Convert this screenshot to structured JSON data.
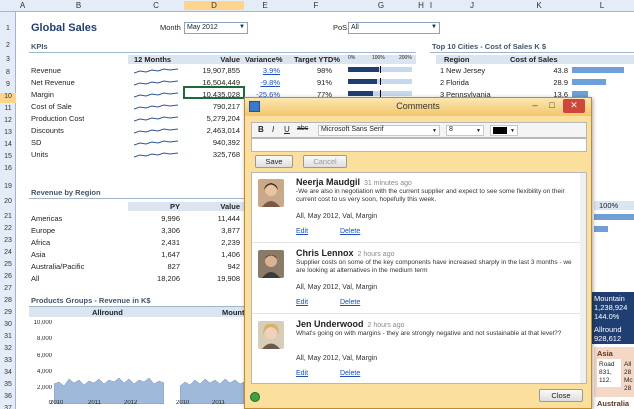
{
  "columns": [
    "A",
    "B",
    "C",
    "D",
    "E",
    "F",
    "G",
    "H",
    "I",
    "J",
    "K",
    "L"
  ],
  "rows": [
    "1",
    "2",
    "3",
    "8",
    "9",
    "10",
    "11",
    "12",
    "13",
    "14",
    "15",
    "16",
    "19",
    "20",
    "21",
    "22",
    "23",
    "24",
    "25",
    "26",
    "27",
    "28",
    "29",
    "30",
    "31",
    "32",
    "33",
    "34",
    "35",
    "36",
    "37",
    "38",
    "39",
    "40"
  ],
  "title": "Global Sales",
  "month_label": "Month",
  "month_value": "May 2012",
  "pos_label": "PoS",
  "pos_value": "All",
  "kpis_header": "KPIs",
  "kpi_columns": {
    "months": "12 Months",
    "value": "Value",
    "variance": "Variance%",
    "target": "Target YTD%"
  },
  "target_ticks": [
    "0%",
    "100%",
    "200%"
  ],
  "kpis": [
    {
      "name": "Revenue",
      "value": "19,907,855",
      "variance": "3.9%",
      "target": "98%",
      "target_fill": 0.49
    },
    {
      "name": "Net Revenue",
      "value": "16,504,449",
      "variance": "-9.8%",
      "target": "91%",
      "target_fill": 0.455
    },
    {
      "name": "Margin",
      "value": "10,435,028",
      "variance": "-25.6%",
      "target": "77%",
      "target_fill": 0.385
    },
    {
      "name": "Cost of Sale",
      "value": "790,217",
      "variance": "",
      "target": "",
      "target_fill": 0
    },
    {
      "name": "Production Cost",
      "value": "5,279,204",
      "variance": "",
      "target": "",
      "target_fill": 0
    },
    {
      "name": "Discounts",
      "value": "2,463,014",
      "variance": "",
      "target": "",
      "target_fill": 0
    },
    {
      "name": "SD",
      "value": "940,392",
      "variance": "",
      "target": "",
      "target_fill": 0
    },
    {
      "name": "Units",
      "value": "325,768",
      "variance": "",
      "target": "",
      "target_fill": 0
    }
  ],
  "top_cities_header": "Top 10 Cities - Cost of Sales K $",
  "top_cities_columns": {
    "region": "Region",
    "cos": "Cost of Sales"
  },
  "top_cities": [
    {
      "rank": "1",
      "region": "New Jersey",
      "value": "43.8",
      "fill": 1.0
    },
    {
      "rank": "2",
      "region": "Florida",
      "value": "28.9",
      "fill": 0.66
    },
    {
      "rank": "3",
      "region": "Pennsylvania",
      "value": "13.6",
      "fill": 0.31
    }
  ],
  "revenue_region_header": "Revenue by Region",
  "region_columns": {
    "py": "PY",
    "value": "Value"
  },
  "regions": [
    {
      "name": "Americas",
      "py": "9,996",
      "value": "11,444"
    },
    {
      "name": "Europe",
      "py": "3,306",
      "value": "3,877"
    },
    {
      "name": "Africa",
      "py": "2,431",
      "value": "2,239"
    },
    {
      "name": "Asia",
      "py": "1,647",
      "value": "1,406"
    },
    {
      "name": "Australia/Pacific",
      "py": "827",
      "value": "942"
    },
    {
      "name": "All",
      "py": "18,206",
      "value": "19,908"
    }
  ],
  "products_header": "Products Groups - Revenue in K$",
  "products_cols": [
    "Allround",
    "Mount"
  ],
  "chart_yticks": [
    "10,000",
    "8,000",
    "6,000",
    "4,000",
    "2,000",
    "0"
  ],
  "chart_xticks": [
    "2010",
    "2011",
    "2012"
  ],
  "right_partial": {
    "r1": "100%",
    "mountain": "Mountain",
    "mountain_v1": "1,238,924",
    "mountain_v2": "144.0%",
    "allround": "Allround",
    "allround_v1": "928,612",
    "asia": "Asia",
    "road": "Road",
    "road_v": "831,",
    "road_v2": "112.",
    "all": "All",
    "all_v": "28",
    "mc": "Mc",
    "mc_v": "28",
    "australia": "Australia"
  },
  "dialog": {
    "title": "Comments",
    "font": "Microsoft Sans Serif",
    "size": "8",
    "bold": "B",
    "italic": "I",
    "underline": "U",
    "strike": "abc",
    "save": "Save",
    "cancel": "Cancel",
    "close": "Close",
    "comments": [
      {
        "author": "Neerja Maudgil",
        "time": "31 minutes ago",
        "text": "-We are also in negotiation with the current supplier and expect to see some flexibility on their current cost to us very soon, hopefully this week.",
        "context": "All, May 2012, Val, Margin",
        "edit": "Edit",
        "delete": "Delete"
      },
      {
        "author": "Chris Lennox",
        "time": "2 hours ago",
        "text": "Supplier costs on some of the key components have increased sharply in the last 3 months - we are looking at alternatives in the medium term",
        "context": "All, May 2012, Val, Margin",
        "edit": "Edit",
        "delete": "Delete"
      },
      {
        "author": "Jen Underwood",
        "time": "2 hours ago",
        "text": "What's going on with margins - they are strongly negative and not sustainable at that level??",
        "context": "All, May 2012, Val, Margin",
        "edit": "Edit",
        "delete": "Delete"
      }
    ]
  },
  "colors": {
    "accent": "#1f3f73",
    "dialog_bg": "#fbdf9c",
    "selected": "#1e6b3a"
  }
}
